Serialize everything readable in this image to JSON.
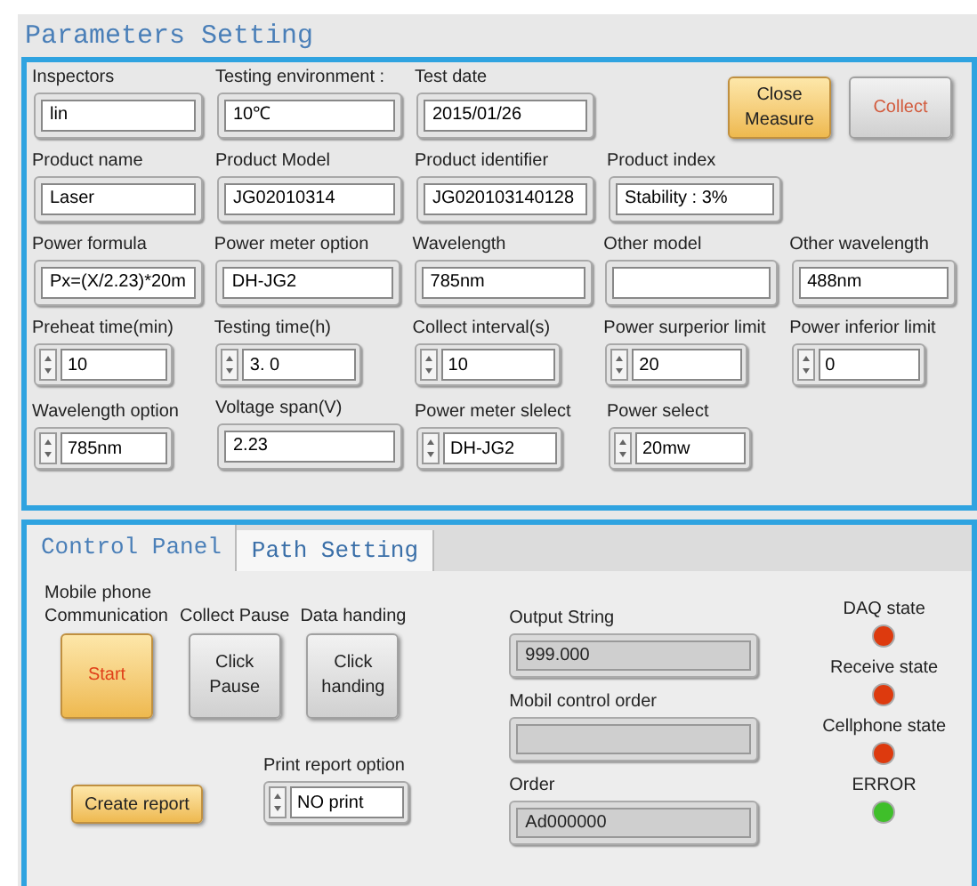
{
  "title": "Parameters Setting",
  "params": {
    "rows": [
      [
        {
          "label": "Inspectors",
          "value": "lin",
          "kind": "text"
        },
        {
          "label": "Testing environment :",
          "value": "10℃",
          "kind": "text"
        },
        {
          "label": "Test date",
          "value": "2015/01/26",
          "kind": "text"
        }
      ],
      [
        {
          "label": "Product name",
          "value": "Laser",
          "kind": "text"
        },
        {
          "label": "Product Model",
          "value": "JG02010314",
          "kind": "text"
        },
        {
          "label": "Product identifier",
          "value": "JG020103140128",
          "kind": "text"
        },
        {
          "label": "Product index",
          "value": "Stability : 3%",
          "kind": "text"
        }
      ],
      [
        {
          "label": "Power formula",
          "value": "Px=(X/2.23)*20m",
          "kind": "text"
        },
        {
          "label": "Power meter option",
          "value": "DH-JG2",
          "kind": "text"
        },
        {
          "label": "Wavelength",
          "value": "785nm",
          "kind": "text"
        },
        {
          "label": "Other model",
          "kind": "text"
        },
        {
          "label": "Other wavelength",
          "value": "488nm",
          "kind": "text"
        }
      ],
      [
        {
          "label": "Preheat time(min)",
          "value": "10",
          "kind": "spin"
        },
        {
          "label": "Testing time(h)",
          "value": "3. 0",
          "kind": "spin"
        },
        {
          "label": "Collect interval(s)",
          "value": "10",
          "kind": "spin"
        },
        {
          "label": "Power surperior limit",
          "value": "20",
          "kind": "spin"
        },
        {
          "label": "Power inferior limit",
          "value": "0",
          "kind": "spin"
        }
      ],
      [
        {
          "label": "Wavelength option",
          "value": "785nm",
          "kind": "spin"
        },
        {
          "label": "Voltage span(V)",
          "value": "2.23",
          "kind": "text"
        },
        {
          "label": "Power meter slelect",
          "value": "DH-JG2",
          "kind": "spin"
        },
        {
          "label": "Power select",
          "value": "20mw",
          "kind": "spin"
        }
      ]
    ],
    "buttons": [
      {
        "label": "Close Measure",
        "on": true
      },
      {
        "label": "Collect",
        "on": false
      }
    ]
  },
  "tabs": [
    {
      "label": "Control Panel",
      "selected": true
    },
    {
      "label": "Path Setting",
      "selected": false
    }
  ],
  "control": {
    "actions": [
      {
        "caption": "Mobile phone Communication",
        "label": "Start",
        "on": true
      },
      {
        "caption": "Collect Pause",
        "label": "Click Pause",
        "on": false
      },
      {
        "caption": "Data handing",
        "label": "Click handing",
        "on": false
      }
    ],
    "report_button": {
      "label": "Create report",
      "on": true
    },
    "print_option": {
      "label": "Print report option",
      "value": "NO print"
    },
    "outputs": [
      {
        "label": "Output String",
        "value": "999.000"
      },
      {
        "label": "Mobil control order"
      },
      {
        "label": "Order",
        "value": "Ad000000"
      }
    ],
    "indicators": [
      {
        "label": "DAQ state",
        "color": "#dd3a0e"
      },
      {
        "label": "Receive state",
        "color": "#dd3a0e"
      },
      {
        "label": "Cellphone state",
        "color": "#dd3a0e"
      },
      {
        "label": "ERROR",
        "color": "#3fbf2a"
      }
    ]
  }
}
